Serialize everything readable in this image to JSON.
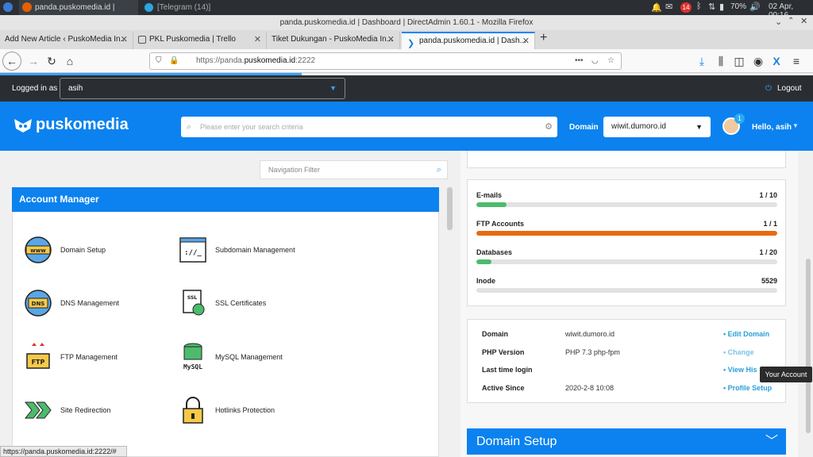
{
  "system_bar": {
    "tasks": [
      "panda.puskomedia.id | Dash...",
      "[Telegram (14)]"
    ],
    "telegram_badge": "14",
    "battery": "70%",
    "datetime": "02 Apr, 00:16"
  },
  "window": {
    "title": "panda.puskomedia.id | Dashboard | DirectAdmin 1.60.1 - Mozilla Firefox"
  },
  "browser": {
    "tabs": [
      {
        "label": "Add New Article ‹ PuskoMedia In..."
      },
      {
        "label": "PKL Puskomedia | Trello"
      },
      {
        "label": "Tiket Dukungan - PuskoMedia In..."
      },
      {
        "label": "panda.puskomedia.id | Dash..."
      }
    ],
    "new_tab": "+",
    "url_prefix": "https://panda.",
    "url_domain": "puskomedia.id",
    "url_suffix": ":2222",
    "status_url": "https://panda.puskomedia.id:2222/#"
  },
  "topbar": {
    "logged_in_label": "Logged in as",
    "user": "asih",
    "logout": "Logout"
  },
  "header": {
    "brand": "puskomedia",
    "search_placeholder": "Please enter your search criteria",
    "domain_label": "Domain",
    "domain_value": "wiwit.dumoro.id",
    "notification_count": "1",
    "greeting": "Hello, asih"
  },
  "sidebar": {
    "nav_filter_placeholder": "Navigation Filter",
    "account_manager_title": "Account Manager",
    "items": [
      {
        "label": "Domain Setup",
        "icon_text": "www"
      },
      {
        "label": "Subdomain Management",
        "icon_text": "://_"
      },
      {
        "label": "DNS Management",
        "icon_text": "DNS"
      },
      {
        "label": "SSL Certificates",
        "icon_text": "SSL"
      },
      {
        "label": "FTP Management",
        "icon_text": "FTP"
      },
      {
        "label": "MySQL Management",
        "icon_text": "MySQL"
      },
      {
        "label": "Site Redirection",
        "icon_text": ""
      },
      {
        "label": "Hotlinks Protection",
        "icon_text": ""
      }
    ]
  },
  "usage": [
    {
      "label": "E-mails",
      "value": "1 / 10",
      "fraction": 0.1,
      "color": "#4cbb6c"
    },
    {
      "label": "FTP Accounts",
      "value": "1 / 1",
      "fraction": 1.0,
      "color": "#e86a10"
    },
    {
      "label": "Databases",
      "value": "1 / 20",
      "fraction": 0.05,
      "color": "#4cbb6c"
    },
    {
      "label": "Inode",
      "value": "5529",
      "fraction": 0.0,
      "color": "#4cbb6c"
    }
  ],
  "info": [
    {
      "key": "Domain",
      "value": "wiwit.dumoro.id",
      "action": "• Edit Domain"
    },
    {
      "key": "PHP Version",
      "value": "PHP 7.3 php-fpm",
      "action": "• Change"
    },
    {
      "key": "Last time login",
      "value": "",
      "action": "• View His"
    },
    {
      "key": "Active Since",
      "value": "2020-2-8 10:08",
      "action": "• Profile Setup"
    }
  ],
  "tooltip": "Your Account",
  "domain_setup_header": "Domain Setup",
  "colors": {
    "brand_blue": "#0b82ef",
    "dark_bar": "#2a2e33",
    "link": "#2a9fd8"
  }
}
